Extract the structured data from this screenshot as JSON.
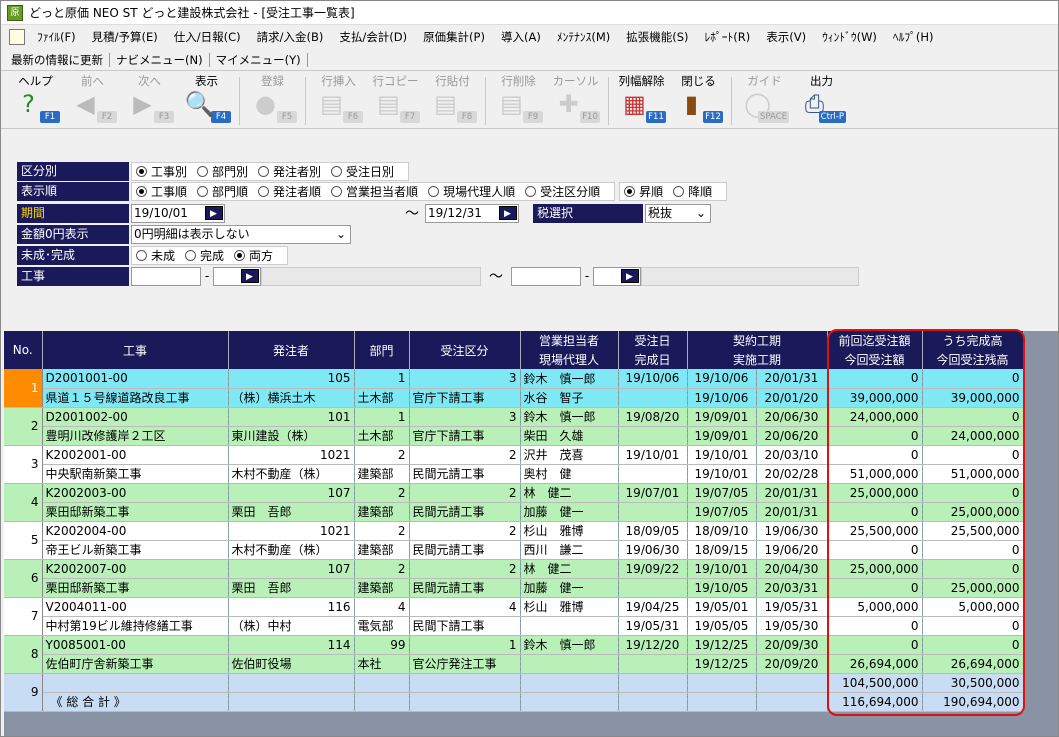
{
  "window": {
    "title": "どっと原価 NEO ST どっと建設株式会社 - [受注工事一覧表]"
  },
  "menu": [
    "ﾌｧｲﾙ(F)",
    "見積/予算(E)",
    "仕入/日報(C)",
    "請求/入金(B)",
    "支払/会計(D)",
    "原価集計(P)",
    "導入(A)",
    "ﾒﾝﾃﾅﾝｽ(M)",
    "拡張機能(S)",
    "ﾚﾎﾟｰﾄ(R)",
    "表示(V)",
    "ｳｨﾝﾄﾞｳ(W)",
    "ﾍﾙﾌﾟ(H)"
  ],
  "nav": [
    "最新の情報に更新",
    "ナビメニュー(N)",
    "マイメニュー(Y)"
  ],
  "toolbar": [
    {
      "label": "ヘルプ",
      "key": "F1",
      "icon": "help-icon",
      "enabled": true
    },
    {
      "label": "前へ",
      "key": "F2",
      "icon": "prev-icon",
      "enabled": false
    },
    {
      "label": "次へ",
      "key": "F3",
      "icon": "next-icon",
      "enabled": false
    },
    {
      "label": "表示",
      "key": "F4",
      "icon": "display-icon",
      "enabled": true
    },
    {
      "label": "登録",
      "key": "F5",
      "icon": "ok-icon",
      "enabled": false
    },
    {
      "label": "行挿入",
      "key": "F6",
      "icon": "row-insert-icon",
      "enabled": false
    },
    {
      "label": "行コピー",
      "key": "F7",
      "icon": "row-copy-icon",
      "enabled": false
    },
    {
      "label": "行貼付",
      "key": "F8",
      "icon": "row-paste-icon",
      "enabled": false
    },
    {
      "label": "行削除",
      "key": "F9",
      "icon": "row-delete-icon",
      "enabled": false
    },
    {
      "label": "カーソル",
      "key": "F10",
      "icon": "cursor-icon",
      "enabled": false
    },
    {
      "label": "列幅解除",
      "key": "F11",
      "icon": "column-width-icon",
      "enabled": true
    },
    {
      "label": "閉じる",
      "key": "F12",
      "icon": "close-door-icon",
      "enabled": true
    },
    {
      "label": "ガイド",
      "key": "SPACE",
      "icon": "guide-icon",
      "enabled": false
    },
    {
      "label": "出力",
      "key": "Ctrl-P",
      "icon": "output-icon",
      "enabled": true
    }
  ],
  "form": {
    "kubetsu": {
      "label": "区分別",
      "options": [
        "工事別",
        "部門別",
        "発注者別",
        "受注日別"
      ],
      "selected": 0
    },
    "order": {
      "label": "表示順",
      "options": [
        "工事順",
        "部門順",
        "発注者順",
        "営業担当者順",
        "現場代理人順",
        "受注区分順"
      ],
      "selected": 0,
      "dir": [
        "昇順",
        "降順"
      ],
      "dir_selected": 0
    },
    "period": {
      "label": "期間",
      "from": "19/10/01",
      "tilde": "～",
      "to": "19/12/31"
    },
    "tax": {
      "label": "税選択",
      "value": "税抜"
    },
    "zero": {
      "label": "金額0円表示",
      "value": "0円明細は表示しない"
    },
    "status": {
      "label": "未成･完成",
      "options": [
        "未成",
        "完成",
        "両方"
      ],
      "selected": 2
    },
    "koji": {
      "label": "工事",
      "dash": "-",
      "tilde": "～"
    }
  },
  "grid": {
    "headers": {
      "no": "No.",
      "koji": "工事",
      "hachu": "発注者",
      "bumon": "部門",
      "kubun": "受注区分",
      "eigyo": "営業担当者",
      "genba": "現場代理人",
      "juchu": "受注日",
      "kansei": "完成日",
      "keiyaku": "契約工期",
      "jisshi": "実施工期",
      "zenkai": "前回迄受注額",
      "konkai": "今回受注額",
      "kansei_daka": "うち完成高",
      "zandaka": "今回受注残高"
    },
    "rows": [
      {
        "no": "1",
        "style": "sel",
        "a": [
          "D2001001-00",
          "105",
          "1",
          "3",
          "鈴木　慎一郎",
          "19/10/06",
          "19/10/06",
          "20/01/31",
          "0",
          "0"
        ],
        "b": [
          "県道１５号線道路改良工事",
          "（株）横浜土木",
          "土木部",
          "官庁下請工事",
          "水谷　智子",
          "",
          "19/10/06",
          "20/01/20",
          "39,000,000",
          "39,000,000"
        ]
      },
      {
        "no": "2",
        "style": "g",
        "a": [
          "D2001002-00",
          "101",
          "1",
          "3",
          "鈴木　慎一郎",
          "19/08/20",
          "19/09/01",
          "20/06/30",
          "24,000,000",
          "0"
        ],
        "b": [
          "豊明川改修護岸２工区",
          "東川建設（株）",
          "土木部",
          "官庁下請工事",
          "柴田　久雄",
          "",
          "19/09/01",
          "20/06/20",
          "0",
          "24,000,000"
        ]
      },
      {
        "no": "3",
        "style": "w",
        "a": [
          "K2002001-00",
          "1021",
          "2",
          "2",
          "沢井　茂喜",
          "19/10/01",
          "19/10/01",
          "20/03/10",
          "0",
          "0"
        ],
        "b": [
          "中央駅南新築工事",
          "木村不動産（株）",
          "建築部",
          "民間元請工事",
          "奥村　健",
          "",
          "19/10/01",
          "20/02/28",
          "51,000,000",
          "51,000,000"
        ]
      },
      {
        "no": "4",
        "style": "g",
        "a": [
          "K2002003-00",
          "107",
          "2",
          "2",
          "林　健二",
          "19/07/01",
          "19/07/05",
          "20/01/31",
          "25,000,000",
          "0"
        ],
        "b": [
          "栗田邸新築工事",
          "栗田　吾郎",
          "建築部",
          "民間元請工事",
          "加藤　健一",
          "",
          "19/07/05",
          "20/01/31",
          "0",
          "25,000,000"
        ]
      },
      {
        "no": "5",
        "style": "w",
        "a": [
          "K2002004-00",
          "1021",
          "2",
          "2",
          "杉山　雅博",
          "18/09/05",
          "18/09/10",
          "19/06/30",
          "25,500,000",
          "25,500,000"
        ],
        "b": [
          "帝王ビル新築工事",
          "木村不動産（株）",
          "建築部",
          "民間元請工事",
          "西川　謙二",
          "19/06/30",
          "18/09/15",
          "19/06/20",
          "0",
          "0"
        ]
      },
      {
        "no": "6",
        "style": "g",
        "a": [
          "K2002007-00",
          "107",
          "2",
          "2",
          "林　健二",
          "19/09/22",
          "19/10/01",
          "20/04/30",
          "25,000,000",
          "0"
        ],
        "b": [
          "栗田邸新築工事",
          "栗田　吾郎",
          "建築部",
          "民間元請工事",
          "加藤　健一",
          "",
          "19/10/05",
          "20/03/31",
          "0",
          "25,000,000"
        ]
      },
      {
        "no": "7",
        "style": "w",
        "a": [
          "V2004011-00",
          "116",
          "4",
          "4",
          "杉山　雅博",
          "19/04/25",
          "19/05/01",
          "19/05/31",
          "5,000,000",
          "5,000,000"
        ],
        "b": [
          "中村第19ビル維持修繕工事",
          "（株）中村",
          "電気部",
          "民間下請工事",
          "",
          "19/05/31",
          "19/05/05",
          "19/05/30",
          "0",
          "0"
        ]
      },
      {
        "no": "8",
        "style": "g",
        "a": [
          "Y0085001-00",
          "114",
          "99",
          "1",
          "鈴木　慎一郎",
          "19/12/20",
          "19/12/25",
          "20/09/30",
          "0",
          "0"
        ],
        "b": [
          "佐伯町庁舎新築工事",
          "佐伯町役場",
          "本社",
          "官公庁発注工事",
          "",
          "",
          "19/12/25",
          "20/09/20",
          "26,694,000",
          "26,694,000"
        ]
      }
    ],
    "total": {
      "no": "9",
      "label": "《 総 合 計 》",
      "zenkai": "104,500,000",
      "kansei_daka": "30,500,000",
      "konkai": "116,694,000",
      "zandaka": "190,694,000"
    }
  }
}
